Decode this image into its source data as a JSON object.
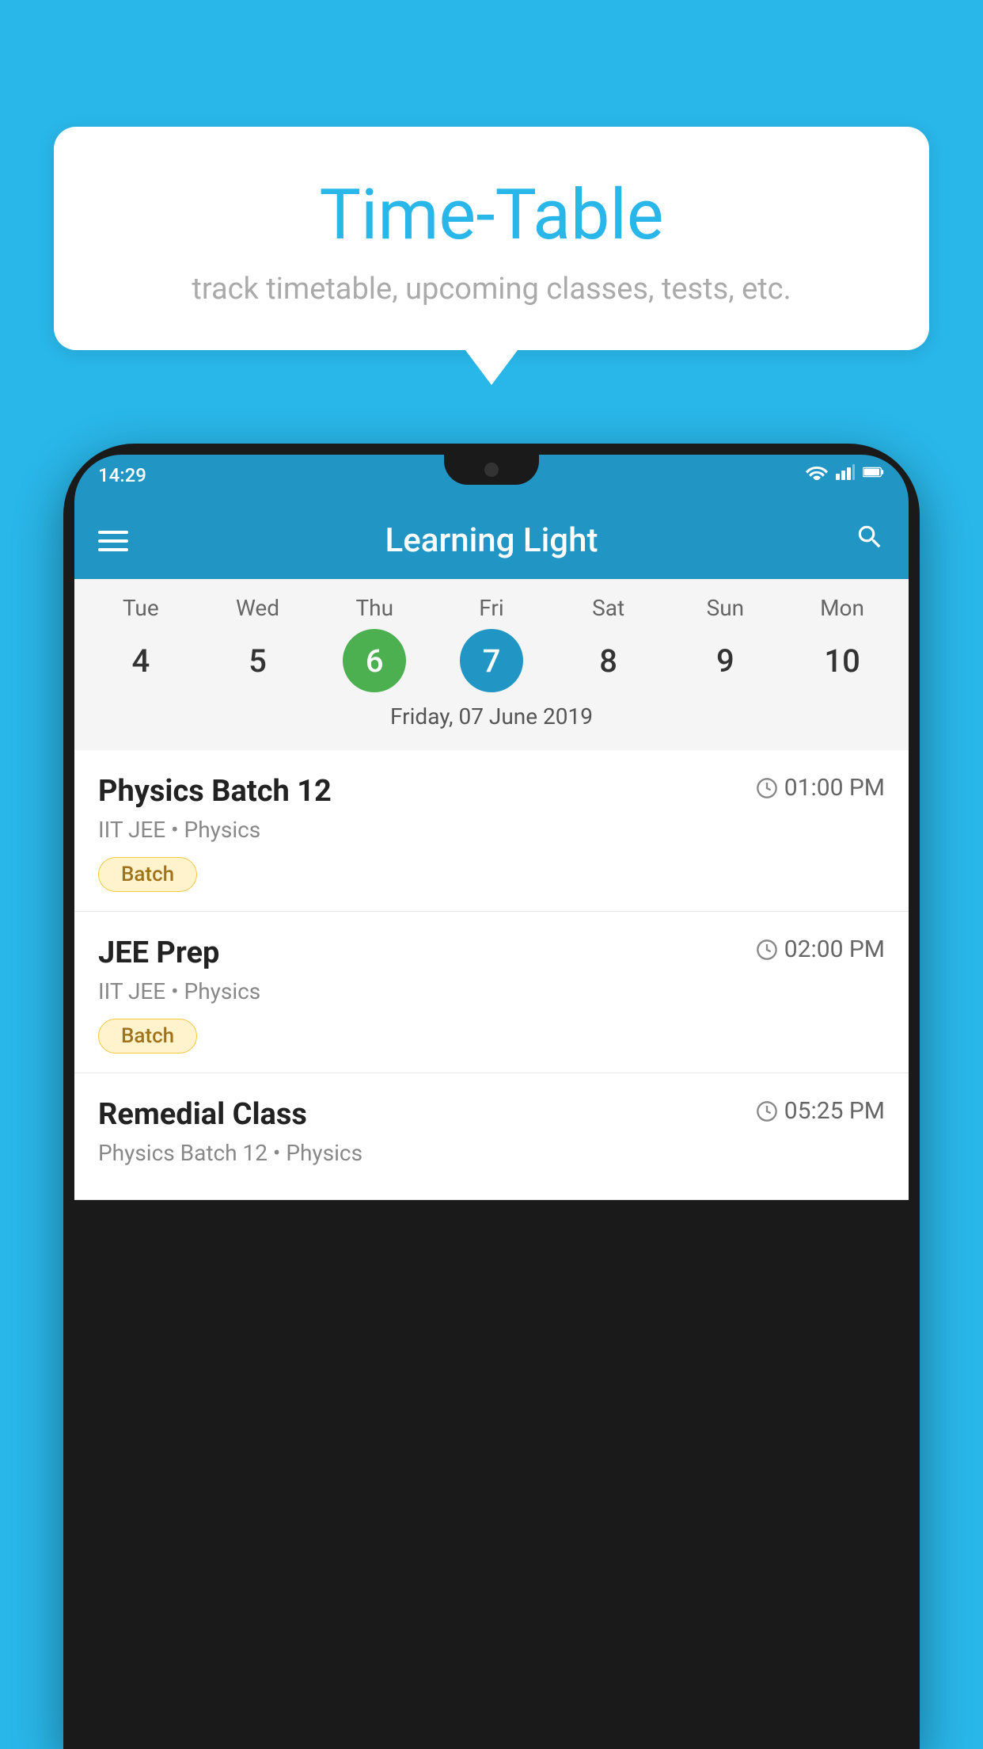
{
  "background_color": "#29b6e8",
  "bubble": {
    "title": "Time-Table",
    "subtitle": "track timetable, upcoming classes, tests, etc."
  },
  "status_bar": {
    "time": "14:29"
  },
  "app_bar": {
    "title": "Learning Light"
  },
  "calendar": {
    "days": [
      {
        "label": "Tue",
        "number": "4"
      },
      {
        "label": "Wed",
        "number": "5"
      },
      {
        "label": "Thu",
        "number": "6",
        "state": "today"
      },
      {
        "label": "Fri",
        "number": "7",
        "state": "selected"
      },
      {
        "label": "Sat",
        "number": "8"
      },
      {
        "label": "Sun",
        "number": "9"
      },
      {
        "label": "Mon",
        "number": "10"
      }
    ],
    "selected_date": "Friday, 07 June 2019"
  },
  "classes": [
    {
      "name": "Physics Batch 12",
      "time": "01:00 PM",
      "subject": "IIT JEE • Physics",
      "tag": "Batch"
    },
    {
      "name": "JEE Prep",
      "time": "02:00 PM",
      "subject": "IIT JEE • Physics",
      "tag": "Batch"
    },
    {
      "name": "Remedial Class",
      "time": "05:25 PM",
      "subject": "Physics Batch 12 • Physics",
      "tag": ""
    }
  ],
  "icons": {
    "menu": "≡",
    "search": "🔍",
    "clock": "🕐"
  }
}
